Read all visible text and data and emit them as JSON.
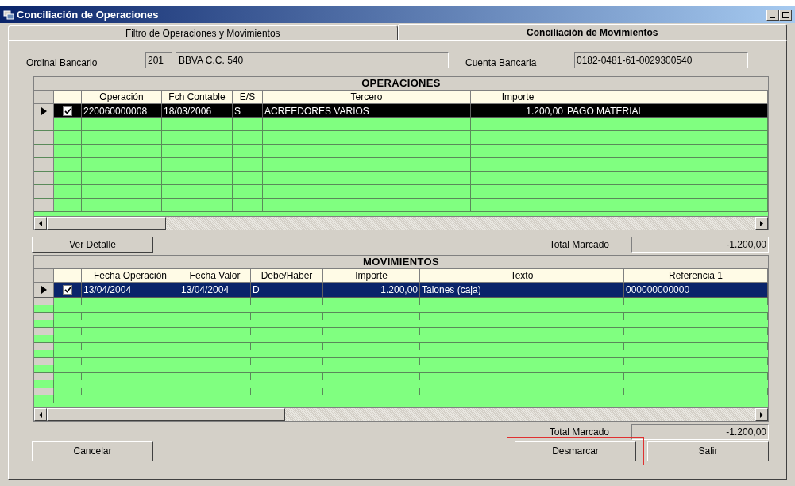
{
  "window": {
    "title": "Conciliación de Operaciones"
  },
  "tabs": [
    {
      "label": "Filtro de Operaciones y Movimientos",
      "selected": false
    },
    {
      "label": "Conciliación de Movimientos",
      "selected": true
    }
  ],
  "ordinal": {
    "label": "Ordinal Bancario",
    "code": "201",
    "name": "BBVA C.C. 540"
  },
  "cuenta": {
    "label": "Cuenta Bancaria",
    "value": "0182-0481-61-0029300540"
  },
  "operaciones": {
    "title": "OPERACIONES",
    "columns": [
      "Operación",
      "Fch Contable",
      "E/S",
      "Tercero",
      "Importe"
    ],
    "rows": [
      {
        "cells": [
          "220060000008",
          "18/03/2006",
          "S",
          "ACREEDORES VARIOS",
          "1.200,00",
          "PAGO MATERIAL"
        ],
        "checked": true,
        "selected": true
      }
    ]
  },
  "ver_detalle": "Ver Detalle",
  "total_operaciones": {
    "label": "Total Marcado",
    "value": "-1.200,00"
  },
  "movimientos": {
    "title": "MOVIMIENTOS",
    "columns": [
      "Fecha Operación",
      "Fecha Valor",
      "Debe/Haber",
      "Importe",
      "Texto",
      "Referencia 1"
    ],
    "rows": [
      {
        "cells": [
          "13/04/2004",
          "13/04/2004",
          "D",
          "1.200,00",
          "Talones (caja)",
          "000000000000"
        ],
        "checked": true,
        "selected": true
      }
    ]
  },
  "total_movimientos": {
    "label": "Total Marcado",
    "value": "-1.200,00"
  },
  "buttons": [
    {
      "label": "Cancelar",
      "highlighted": false
    },
    {
      "label": "Desmarcar",
      "highlighted": true
    },
    {
      "label": "Salir",
      "highlighted": false
    }
  ]
}
